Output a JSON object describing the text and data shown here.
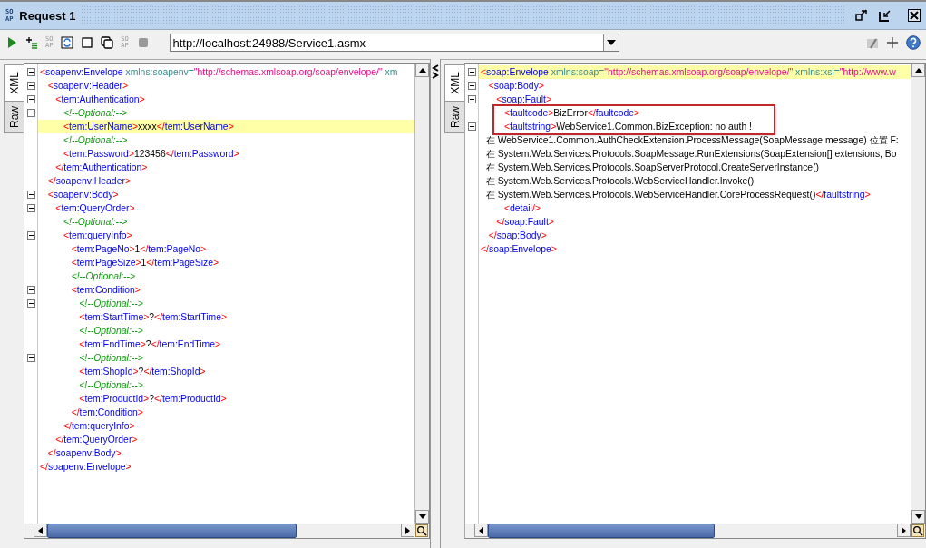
{
  "window": {
    "title": "Request 1",
    "icon_label": "SOAP"
  },
  "toolbar": {
    "soap_labels": [
      "SOAP",
      "SOAP"
    ],
    "url": "http://localhost:24988/Service1.asmx"
  },
  "panes": [
    {
      "tabs": [
        {
          "label": "XML",
          "selected": true
        },
        {
          "label": "Raw",
          "selected": false
        }
      ],
      "lines": [
        {
          "fold": true,
          "highlighted": false,
          "boxed": false,
          "parts": [
            {
              "kind": "punct",
              "t": "<"
            },
            {
              "kind": "name",
              "t": "soapenv:Envelope"
            },
            {
              "kind": "attr",
              "t": " xmlns:soapenv="
            },
            {
              "kind": "value",
              "t": "\"http://schemas.xmlsoap.org/soap/envelope/\""
            },
            {
              "kind": "attr",
              "t": " xm"
            }
          ]
        },
        {
          "fold": true,
          "highlighted": false,
          "boxed": false,
          "parts": [
            {
              "kind": "punct",
              "t": "   <"
            },
            {
              "kind": "name",
              "t": "soapenv:Header"
            },
            {
              "kind": "punct",
              "t": ">"
            }
          ]
        },
        {
          "fold": true,
          "highlighted": false,
          "boxed": false,
          "parts": [
            {
              "kind": "punct",
              "t": "      <"
            },
            {
              "kind": "name",
              "t": "tem:Authentication"
            },
            {
              "kind": "punct",
              "t": ">"
            }
          ]
        },
        {
          "fold": true,
          "highlighted": false,
          "boxed": false,
          "parts": [
            {
              "kind": "comment",
              "t": "         <!--Optional:-->"
            }
          ]
        },
        {
          "fold": false,
          "highlighted": true,
          "boxed": false,
          "parts": [
            {
              "kind": "punct",
              "t": "         <"
            },
            {
              "kind": "name",
              "t": "tem:UserName"
            },
            {
              "kind": "punct",
              "t": ">"
            },
            {
              "kind": "text",
              "t": "xxxx"
            },
            {
              "kind": "punct",
              "t": "</"
            },
            {
              "kind": "name",
              "t": "tem:UserName"
            },
            {
              "kind": "punct",
              "t": ">"
            }
          ]
        },
        {
          "fold": false,
          "highlighted": false,
          "boxed": false,
          "parts": [
            {
              "kind": "comment",
              "t": "         <!--Optional:-->"
            }
          ]
        },
        {
          "fold": false,
          "highlighted": false,
          "boxed": false,
          "parts": [
            {
              "kind": "punct",
              "t": "         <"
            },
            {
              "kind": "name",
              "t": "tem:Password"
            },
            {
              "kind": "punct",
              "t": ">"
            },
            {
              "kind": "text",
              "t": "123456"
            },
            {
              "kind": "punct",
              "t": "</"
            },
            {
              "kind": "name",
              "t": "tem:Password"
            },
            {
              "kind": "punct",
              "t": ">"
            }
          ]
        },
        {
          "fold": false,
          "highlighted": false,
          "boxed": false,
          "parts": [
            {
              "kind": "punct",
              "t": "      </"
            },
            {
              "kind": "name",
              "t": "tem:Authentication"
            },
            {
              "kind": "punct",
              "t": ">"
            }
          ]
        },
        {
          "fold": false,
          "highlighted": false,
          "boxed": false,
          "parts": [
            {
              "kind": "punct",
              "t": "   </"
            },
            {
              "kind": "name",
              "t": "soapenv:Header"
            },
            {
              "kind": "punct",
              "t": ">"
            }
          ]
        },
        {
          "fold": true,
          "highlighted": false,
          "boxed": false,
          "parts": [
            {
              "kind": "punct",
              "t": "   <"
            },
            {
              "kind": "name",
              "t": "soapenv:Body"
            },
            {
              "kind": "punct",
              "t": ">"
            }
          ]
        },
        {
          "fold": true,
          "highlighted": false,
          "boxed": false,
          "parts": [
            {
              "kind": "punct",
              "t": "      <"
            },
            {
              "kind": "name",
              "t": "tem:QueryOrder"
            },
            {
              "kind": "punct",
              "t": ">"
            }
          ]
        },
        {
          "fold": false,
          "highlighted": false,
          "boxed": false,
          "parts": [
            {
              "kind": "comment",
              "t": "         <!--Optional:-->"
            }
          ]
        },
        {
          "fold": true,
          "highlighted": false,
          "boxed": false,
          "parts": [
            {
              "kind": "punct",
              "t": "         <"
            },
            {
              "kind": "name",
              "t": "tem:queryInfo"
            },
            {
              "kind": "punct",
              "t": ">"
            }
          ]
        },
        {
          "fold": false,
          "highlighted": false,
          "boxed": false,
          "parts": [
            {
              "kind": "punct",
              "t": "            <"
            },
            {
              "kind": "name",
              "t": "tem:PageNo"
            },
            {
              "kind": "punct",
              "t": ">"
            },
            {
              "kind": "text",
              "t": "1"
            },
            {
              "kind": "punct",
              "t": "</"
            },
            {
              "kind": "name",
              "t": "tem:PageNo"
            },
            {
              "kind": "punct",
              "t": ">"
            }
          ]
        },
        {
          "fold": false,
          "highlighted": false,
          "boxed": false,
          "parts": [
            {
              "kind": "punct",
              "t": "            <"
            },
            {
              "kind": "name",
              "t": "tem:PageSize"
            },
            {
              "kind": "punct",
              "t": ">"
            },
            {
              "kind": "text",
              "t": "1"
            },
            {
              "kind": "punct",
              "t": "</"
            },
            {
              "kind": "name",
              "t": "tem:PageSize"
            },
            {
              "kind": "punct",
              "t": ">"
            }
          ]
        },
        {
          "fold": false,
          "highlighted": false,
          "boxed": false,
          "parts": [
            {
              "kind": "comment",
              "t": "            <!--Optional:-->"
            }
          ]
        },
        {
          "fold": true,
          "highlighted": false,
          "boxed": false,
          "parts": [
            {
              "kind": "punct",
              "t": "            <"
            },
            {
              "kind": "name",
              "t": "tem:Condition"
            },
            {
              "kind": "punct",
              "t": ">"
            }
          ]
        },
        {
          "fold": true,
          "highlighted": false,
          "boxed": false,
          "parts": [
            {
              "kind": "comment",
              "t": "               <!--Optional:-->"
            }
          ]
        },
        {
          "fold": false,
          "highlighted": false,
          "boxed": false,
          "parts": [
            {
              "kind": "punct",
              "t": "               <"
            },
            {
              "kind": "name",
              "t": "tem:StartTime"
            },
            {
              "kind": "punct",
              "t": ">"
            },
            {
              "kind": "text",
              "t": "?"
            },
            {
              "kind": "punct",
              "t": "</"
            },
            {
              "kind": "name",
              "t": "tem:StartTime"
            },
            {
              "kind": "punct",
              "t": ">"
            }
          ]
        },
        {
          "fold": false,
          "highlighted": false,
          "boxed": false,
          "parts": [
            {
              "kind": "comment",
              "t": "               <!--Optional:-->"
            }
          ]
        },
        {
          "fold": false,
          "highlighted": false,
          "boxed": false,
          "parts": [
            {
              "kind": "punct",
              "t": "               <"
            },
            {
              "kind": "name",
              "t": "tem:EndTime"
            },
            {
              "kind": "punct",
              "t": ">"
            },
            {
              "kind": "text",
              "t": "?"
            },
            {
              "kind": "punct",
              "t": "</"
            },
            {
              "kind": "name",
              "t": "tem:EndTime"
            },
            {
              "kind": "punct",
              "t": ">"
            }
          ]
        },
        {
          "fold": true,
          "highlighted": false,
          "boxed": false,
          "parts": [
            {
              "kind": "comment",
              "t": "               <!--Optional:-->"
            }
          ]
        },
        {
          "fold": false,
          "highlighted": false,
          "boxed": false,
          "parts": [
            {
              "kind": "punct",
              "t": "               <"
            },
            {
              "kind": "name",
              "t": "tem:ShopId"
            },
            {
              "kind": "punct",
              "t": ">"
            },
            {
              "kind": "text",
              "t": "?"
            },
            {
              "kind": "punct",
              "t": "</"
            },
            {
              "kind": "name",
              "t": "tem:ShopId"
            },
            {
              "kind": "punct",
              "t": ">"
            }
          ]
        },
        {
          "fold": false,
          "highlighted": false,
          "boxed": false,
          "parts": [
            {
              "kind": "comment",
              "t": "               <!--Optional:-->"
            }
          ]
        },
        {
          "fold": false,
          "highlighted": false,
          "boxed": false,
          "parts": [
            {
              "kind": "punct",
              "t": "               <"
            },
            {
              "kind": "name",
              "t": "tem:ProductId"
            },
            {
              "kind": "punct",
              "t": ">"
            },
            {
              "kind": "text",
              "t": "?"
            },
            {
              "kind": "punct",
              "t": "</"
            },
            {
              "kind": "name",
              "t": "tem:ProductId"
            },
            {
              "kind": "punct",
              "t": ">"
            }
          ]
        },
        {
          "fold": false,
          "highlighted": false,
          "boxed": false,
          "parts": [
            {
              "kind": "punct",
              "t": "            </"
            },
            {
              "kind": "name",
              "t": "tem:Condition"
            },
            {
              "kind": "punct",
              "t": ">"
            }
          ]
        },
        {
          "fold": false,
          "highlighted": false,
          "boxed": false,
          "parts": [
            {
              "kind": "punct",
              "t": "         </"
            },
            {
              "kind": "name",
              "t": "tem:queryInfo"
            },
            {
              "kind": "punct",
              "t": ">"
            }
          ]
        },
        {
          "fold": false,
          "highlighted": false,
          "boxed": false,
          "parts": [
            {
              "kind": "punct",
              "t": "      </"
            },
            {
              "kind": "name",
              "t": "tem:QueryOrder"
            },
            {
              "kind": "punct",
              "t": ">"
            }
          ]
        },
        {
          "fold": false,
          "highlighted": false,
          "boxed": false,
          "parts": [
            {
              "kind": "punct",
              "t": "   </"
            },
            {
              "kind": "name",
              "t": "soapenv:Body"
            },
            {
              "kind": "punct",
              "t": ">"
            }
          ]
        },
        {
          "fold": false,
          "highlighted": false,
          "boxed": false,
          "parts": [
            {
              "kind": "punct",
              "t": "</"
            },
            {
              "kind": "name",
              "t": "soapenv:Envelope"
            },
            {
              "kind": "punct",
              "t": ">"
            }
          ]
        }
      ]
    },
    {
      "tabs": [
        {
          "label": "XML",
          "selected": true
        },
        {
          "label": "Raw",
          "selected": false
        }
      ],
      "lines": [
        {
          "fold": true,
          "highlighted": true,
          "boxed": false,
          "parts": [
            {
              "kind": "punct",
              "t": "<"
            },
            {
              "kind": "name",
              "t": "soap:Envelope"
            },
            {
              "kind": "attr",
              "t": " xmlns:soap="
            },
            {
              "kind": "value",
              "t": "\"http://schemas.xmlsoap.org/soap/envelope/\""
            },
            {
              "kind": "attr",
              "t": " xmlns:xsi="
            },
            {
              "kind": "value",
              "t": "\"http://www.w"
            }
          ]
        },
        {
          "fold": true,
          "highlighted": false,
          "boxed": false,
          "parts": [
            {
              "kind": "punct",
              "t": "   <"
            },
            {
              "kind": "name",
              "t": "soap:Body"
            },
            {
              "kind": "punct",
              "t": ">"
            }
          ]
        },
        {
          "fold": true,
          "highlighted": false,
          "boxed": false,
          "parts": [
            {
              "kind": "punct",
              "t": "      <"
            },
            {
              "kind": "name",
              "t": "soap:Fault"
            },
            {
              "kind": "punct",
              "t": ">"
            }
          ]
        },
        {
          "fold": false,
          "highlighted": false,
          "boxed": true,
          "parts": [
            {
              "kind": "punct",
              "t": "         <"
            },
            {
              "kind": "name",
              "t": "faultcode"
            },
            {
              "kind": "punct",
              "t": ">"
            },
            {
              "kind": "text",
              "t": "BizError"
            },
            {
              "kind": "punct",
              "t": "</"
            },
            {
              "kind": "name",
              "t": "faultcode"
            },
            {
              "kind": "punct",
              "t": ">"
            }
          ]
        },
        {
          "fold": true,
          "highlighted": false,
          "boxed": true,
          "parts": [
            {
              "kind": "punct",
              "t": "         <"
            },
            {
              "kind": "name",
              "t": "faultstring"
            },
            {
              "kind": "punct",
              "t": ">"
            },
            {
              "kind": "text",
              "t": "WebService1.Common.BizException: no auth !"
            }
          ]
        },
        {
          "fold": false,
          "highlighted": false,
          "boxed": false,
          "parts": [
            {
              "kind": "text",
              "t": "  在 WebService1.Common.AuthCheckExtension.ProcessMessage(SoapMessage message) 位置 F:"
            }
          ]
        },
        {
          "fold": false,
          "highlighted": false,
          "boxed": false,
          "parts": [
            {
              "kind": "text",
              "t": "  在 System.Web.Services.Protocols.SoapMessage.RunExtensions(SoapExtension[] extensions, Bo"
            }
          ]
        },
        {
          "fold": false,
          "highlighted": false,
          "boxed": false,
          "parts": [
            {
              "kind": "text",
              "t": "  在 System.Web.Services.Protocols.SoapServerProtocol.CreateServerInstance()"
            }
          ]
        },
        {
          "fold": false,
          "highlighted": false,
          "boxed": false,
          "parts": [
            {
              "kind": "text",
              "t": "  在 System.Web.Services.Protocols.WebServiceHandler.Invoke()"
            }
          ]
        },
        {
          "fold": false,
          "highlighted": false,
          "boxed": false,
          "parts": [
            {
              "kind": "text",
              "t": "  在 System.Web.Services.Protocols.WebServiceHandler.CoreProcessRequest()"
            },
            {
              "kind": "punct",
              "t": "</"
            },
            {
              "kind": "name",
              "t": "faultstring"
            },
            {
              "kind": "punct",
              "t": ">"
            }
          ]
        },
        {
          "fold": false,
          "highlighted": false,
          "boxed": false,
          "parts": [
            {
              "kind": "punct",
              "t": "         <"
            },
            {
              "kind": "name",
              "t": "detail"
            },
            {
              "kind": "punct",
              "t": "/>"
            }
          ]
        },
        {
          "fold": false,
          "highlighted": false,
          "boxed": false,
          "parts": [
            {
              "kind": "punct",
              "t": "      </"
            },
            {
              "kind": "name",
              "t": "soap:Fault"
            },
            {
              "kind": "punct",
              "t": ">"
            }
          ]
        },
        {
          "fold": false,
          "highlighted": false,
          "boxed": false,
          "parts": [
            {
              "kind": "punct",
              "t": "   </"
            },
            {
              "kind": "name",
              "t": "soap:Body"
            },
            {
              "kind": "punct",
              "t": ">"
            }
          ]
        },
        {
          "fold": false,
          "highlighted": false,
          "boxed": false,
          "parts": [
            {
              "kind": "punct",
              "t": "</"
            },
            {
              "kind": "name",
              "t": "soap:Envelope"
            },
            {
              "kind": "punct",
              "t": ">"
            }
          ]
        }
      ]
    }
  ]
}
